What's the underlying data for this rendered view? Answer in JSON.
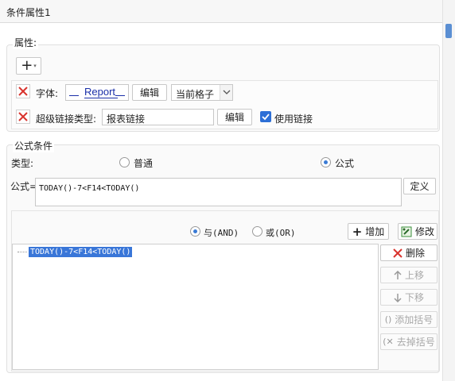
{
  "window": {
    "title": "条件属性1"
  },
  "attributes": {
    "section_label": "属性:",
    "add_button": "+",
    "font_row": {
      "label": "字体:",
      "font_preview": "Report",
      "edit_button": "编辑",
      "scope_value": "当前格子"
    },
    "hyperlink_row": {
      "label": "超级链接类型:",
      "value": "报表链接",
      "edit_button": "编辑",
      "use_link_label": "使用链接",
      "use_link_checked": true
    }
  },
  "formula_condition": {
    "section_label": "公式条件",
    "type_label": "类型:",
    "type_options": [
      "普通",
      "公式"
    ],
    "type_selected": "公式",
    "formula_label": "公式=",
    "formula_value": "TODAY()-7<F14<TODAY()",
    "define_button": "定义",
    "logic_options": [
      "与(AND)",
      "或(OR)"
    ],
    "logic_selected": "与(AND)",
    "add_button": "增加",
    "modify_button": "修改",
    "delete_button": "删除",
    "move_up_button": "上移",
    "move_down_button": "下移",
    "add_bracket_button": "添加括号",
    "remove_bracket_button": "去掉括号",
    "conditions": [
      "TODAY()-7<F14<TODAY()"
    ]
  }
}
